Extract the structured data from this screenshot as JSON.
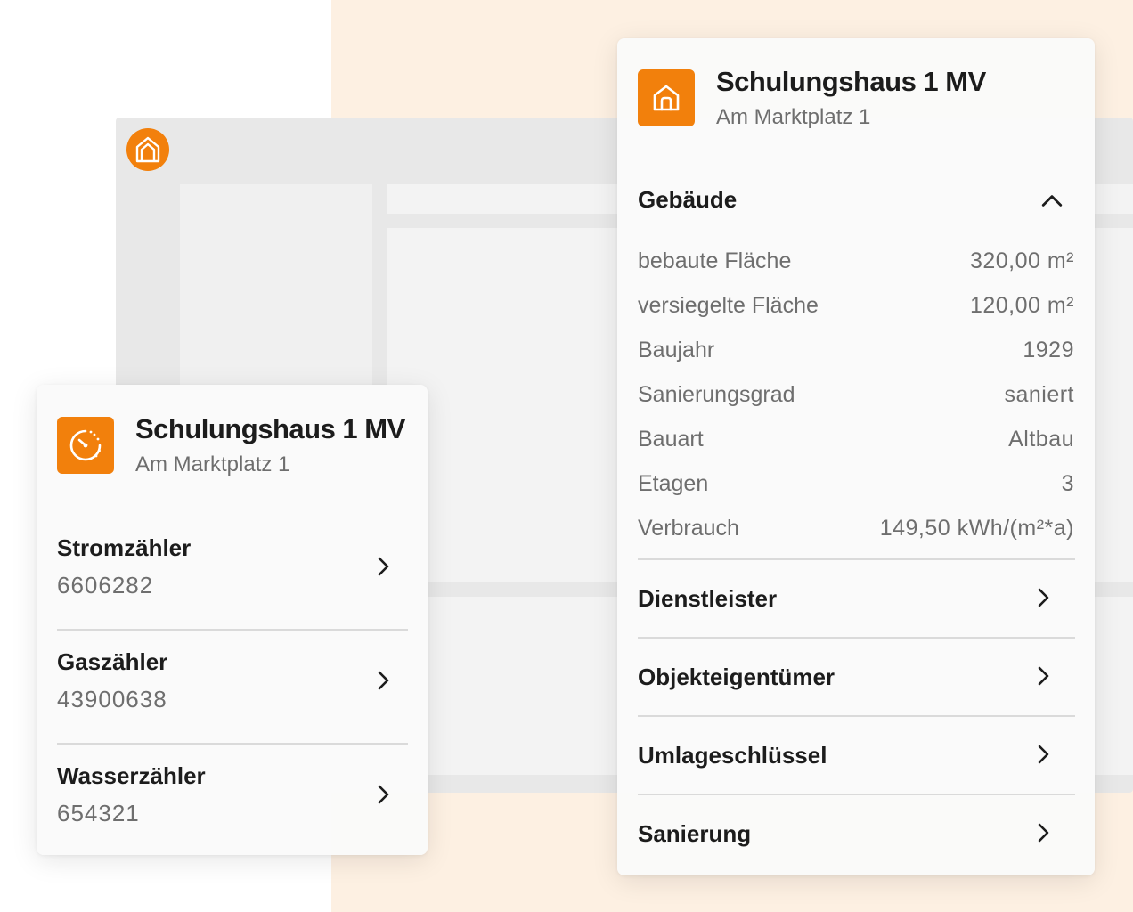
{
  "theme": {
    "accent": "#f2800c",
    "background_tint": "#fdf0e2"
  },
  "app": {
    "logo_icon": "house-logo-icon"
  },
  "meter_card": {
    "icon": "meter-gauge-icon",
    "title": "Schulungshaus 1 MV",
    "address": "Am Marktplatz 1",
    "meters": [
      {
        "name": "Stromzähler",
        "number": "6606282"
      },
      {
        "name": "Gaszähler",
        "number": "43900638"
      },
      {
        "name": "Wasserzähler",
        "number": "654321"
      }
    ]
  },
  "building_card": {
    "icon": "house-icon",
    "title": "Schulungshaus 1 MV",
    "address": "Am Marktplatz 1",
    "section_title": "Gebäude",
    "properties": [
      {
        "label": "bebaute Fläche",
        "value": "320,00 m²"
      },
      {
        "label": "versiegelte Fläche",
        "value": "120,00 m²"
      },
      {
        "label": "Baujahr",
        "value": "1929"
      },
      {
        "label": "Sanierungsgrad",
        "value": "saniert"
      },
      {
        "label": "Bauart",
        "value": "Altbau"
      },
      {
        "label": "Etagen",
        "value": "3"
      },
      {
        "label": "Verbrauch",
        "value": "149,50 kWh/(m²*a)"
      }
    ],
    "nav_items": [
      {
        "label": "Dienstleister"
      },
      {
        "label": "Objekteigentümer"
      },
      {
        "label": "Umlageschlüssel"
      },
      {
        "label": "Sanierung"
      }
    ]
  }
}
